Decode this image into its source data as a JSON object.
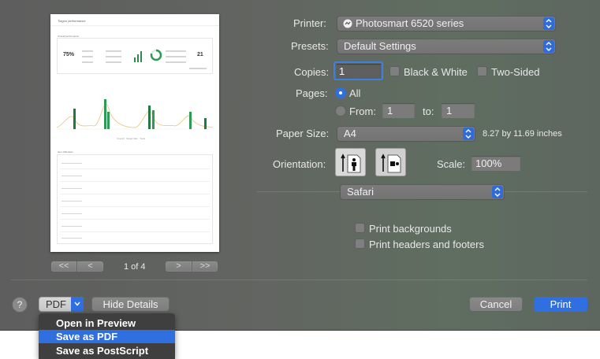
{
  "preview": {
    "page_title": "Tiagno performance",
    "section1_title": "Overall performance",
    "big_left": "75%",
    "big_right": "21",
    "legend": [
      "Overall",
      "Target Max",
      "Tests"
    ],
    "section2_title": "Item difficulties",
    "page_indicator": "1 of 4",
    "nav_first": "<<",
    "nav_prev": "<",
    "nav_next": ">",
    "nav_last": ">>"
  },
  "printer": {
    "label": "Printer:",
    "value": "Photosmart 6520 series"
  },
  "presets": {
    "label": "Presets:",
    "value": "Default Settings"
  },
  "copies": {
    "label": "Copies:",
    "value": "1",
    "bw_label": "Black & White",
    "two_sided_label": "Two-Sided"
  },
  "pages": {
    "label": "Pages:",
    "all_label": "All",
    "from_label": "From:",
    "from_value": "1",
    "to_label": "to:",
    "to_value": "1"
  },
  "paper_size": {
    "label": "Paper Size:",
    "value": "A4",
    "dimensions": "8.27 by 11.69 inches"
  },
  "orientation": {
    "label": "Orientation:"
  },
  "scale": {
    "label": "Scale:",
    "value": "100%"
  },
  "app_section": {
    "value": "Safari"
  },
  "options": {
    "print_backgrounds": "Print backgrounds",
    "print_headers_footers": "Print headers and footers"
  },
  "bottom": {
    "help": "?",
    "pdf_label": "PDF",
    "hide_details": "Hide Details",
    "cancel": "Cancel",
    "print": "Print"
  },
  "pdf_menu": {
    "items": [
      "Open in Preview",
      "Save as PDF",
      "Save as PostScript"
    ],
    "selected": 1
  },
  "colors": {
    "accent": "#2f6bd9",
    "print_button": "#2f6fe0"
  }
}
